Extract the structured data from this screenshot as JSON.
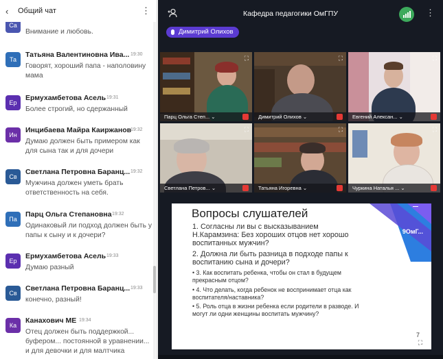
{
  "chat": {
    "title": "Общий чат",
    "back_icon": "‹",
    "menu_icon": "⋮",
    "messages": [
      {
        "initials": "Са",
        "color": "#4a56b0",
        "name": "",
        "time": "",
        "text": "Внимание и любовь."
      },
      {
        "initials": "Та",
        "color": "#2f6fb8",
        "name": "Татьяна Валентиновна Ива...",
        "time": "19:30",
        "text": "Говорят, хороший папа - наполовину мама"
      },
      {
        "initials": "Ер",
        "color": "#5b2fb0",
        "name": "Ермухамбетова Асель",
        "time": "19:31",
        "text": "Более строгий, но сдержанный"
      },
      {
        "initials": "Ин",
        "color": "#6b2fa8",
        "name": "Инцибаева Майра Каиржанов",
        "time": "19:32",
        "text": "Думаю должен быть примером как для сына так и для дочери"
      },
      {
        "initials": "Св",
        "color": "#2a5a96",
        "name": "Светлана Петровна Баранц...",
        "time": "19:32",
        "text": "Мужчина должен уметь брать ответственность на себя."
      },
      {
        "initials": "Па",
        "color": "#2f6fb8",
        "name": "Парц Ольга Степановна",
        "time": "19:32",
        "text": "Одинаковый ли подход должен быть у папы к сыну и к дочери?"
      },
      {
        "initials": "Ер",
        "color": "#5b2fb0",
        "name": "Ермухамбетова Асель",
        "time": "19:33",
        "text": "Думаю разный"
      },
      {
        "initials": "Св",
        "color": "#2a5a96",
        "name": "Светлана Петровна Баранц...",
        "time": "19:33",
        "text": "конечно, разный!"
      },
      {
        "initials": "Ка",
        "color": "#6b2fa8",
        "name": "Канахович МЕ",
        "time": "19:34",
        "text": "Отец должен быть поддержкой... буфером... постоянной в уравнении... и для девочки и для малтчика"
      }
    ]
  },
  "conference": {
    "title": "Кафедра педагогики ОмГПУ",
    "menu_icon": "⋮",
    "speaker": "Димитрий Олихов",
    "expand_icon": "⛶",
    "tiles": [
      {
        "label": "Парц Ольга Степ... ⌄"
      },
      {
        "label": "Димитрий Олихов ⌄"
      },
      {
        "label": "Евгений Алексан... ⌄"
      },
      {
        "label": "Светлана Петров... ⌄"
      },
      {
        "label": "Татьяна Игоревна ⌄"
      },
      {
        "label": "Чуркина Наталья ... ⌄"
      }
    ]
  },
  "slide": {
    "title": "Вопросы слушателей",
    "logo": "9ОмГ...",
    "q1": "1. Согласны ли вы с высказыванием Н.Карамзина: Без хороших отцов нет хорошо воспитанных мужчин?",
    "q2": "2. Должна ли быть разница в подходе папы к воспитанию сына и дочери?",
    "q3": "• 3. Как воспитать ребенка, чтобы он стал в будущем прекрасным отцом?",
    "q4": "• 4. Что делать, когда ребенок не воспринимает отца как воспитателя/наставника?",
    "q5": "• 5. Роль отца в жизни ребенка если родители в разводе. И могут ли одни женщины воспитать мужчину?",
    "page": "7"
  }
}
